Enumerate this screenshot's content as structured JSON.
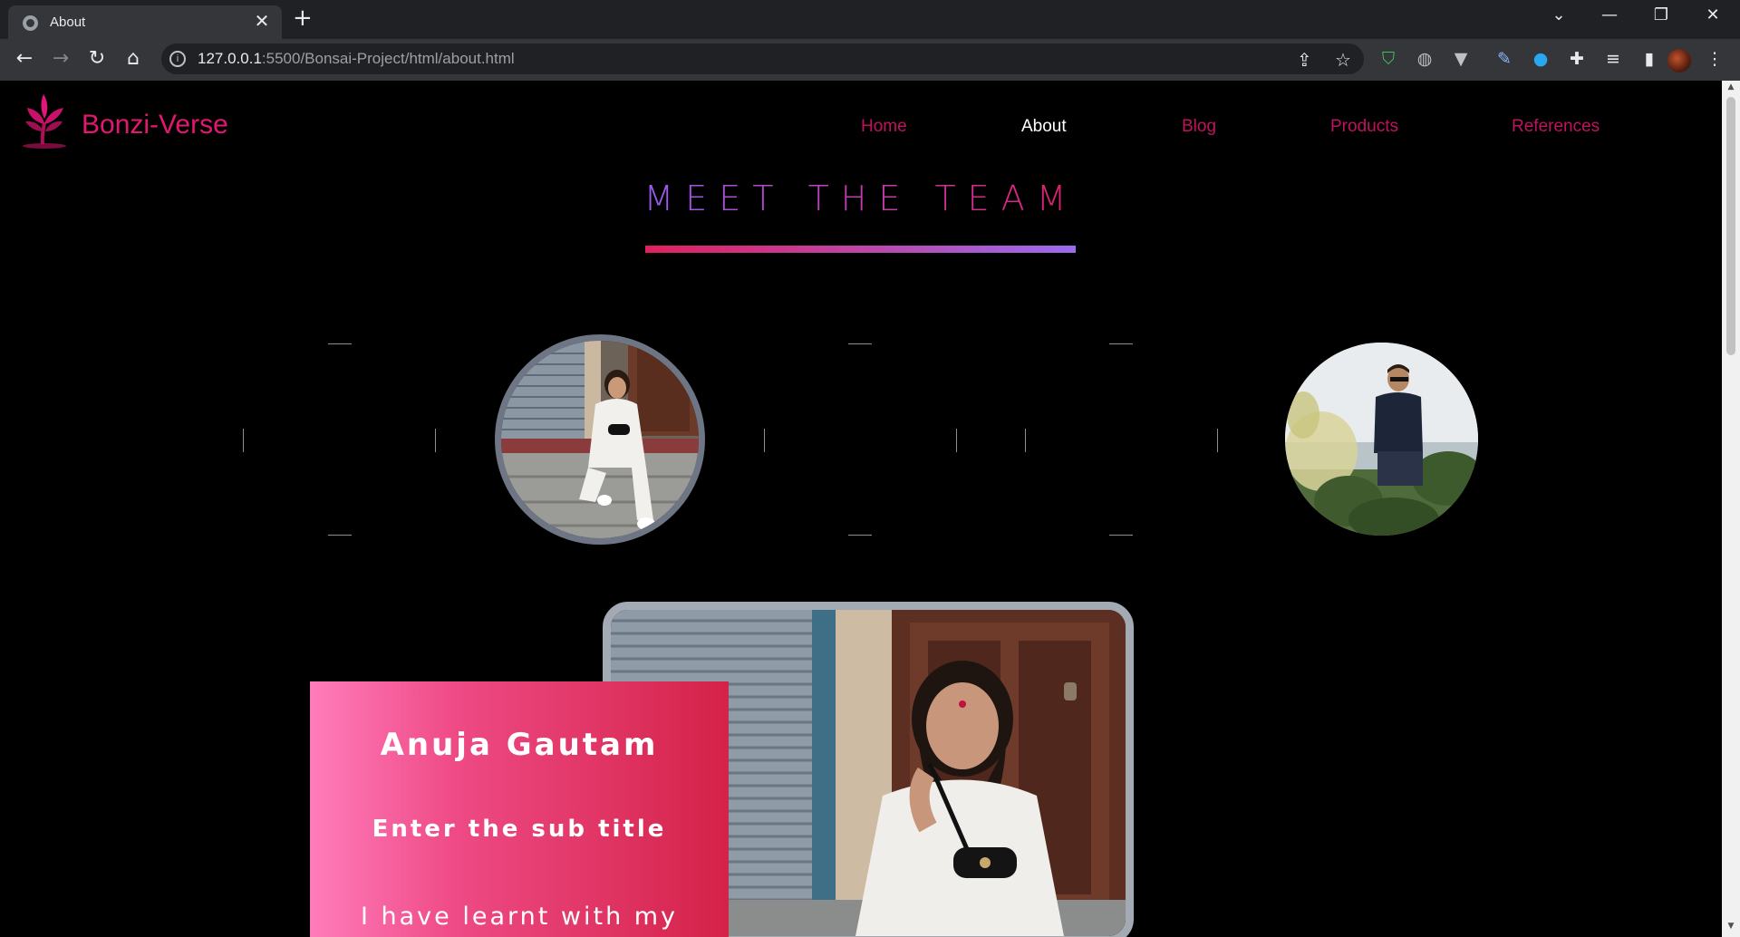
{
  "browser": {
    "tab_title": "About",
    "url_host": "127.0.0.1",
    "url_rest": ":5500/Bonsai-Project/html/about.html"
  },
  "site": {
    "brand": "Bonzi-Verse",
    "brand_color": "#e3176f",
    "nav": [
      {
        "label": "Home",
        "active": false
      },
      {
        "label": "About",
        "active": true
      },
      {
        "label": "Blog",
        "active": false
      },
      {
        "label": "Products",
        "active": false
      },
      {
        "label": "References",
        "active": false
      }
    ]
  },
  "section": {
    "heading": "MEET THE TEAM",
    "gradient_colors": [
      "#e0205f",
      "#9b6bf0"
    ]
  },
  "team": {
    "selected_index": 1,
    "featured": {
      "name": "Anuja Gautam",
      "subtitle": "Enter the sub title",
      "description": "I have learnt with my"
    }
  }
}
